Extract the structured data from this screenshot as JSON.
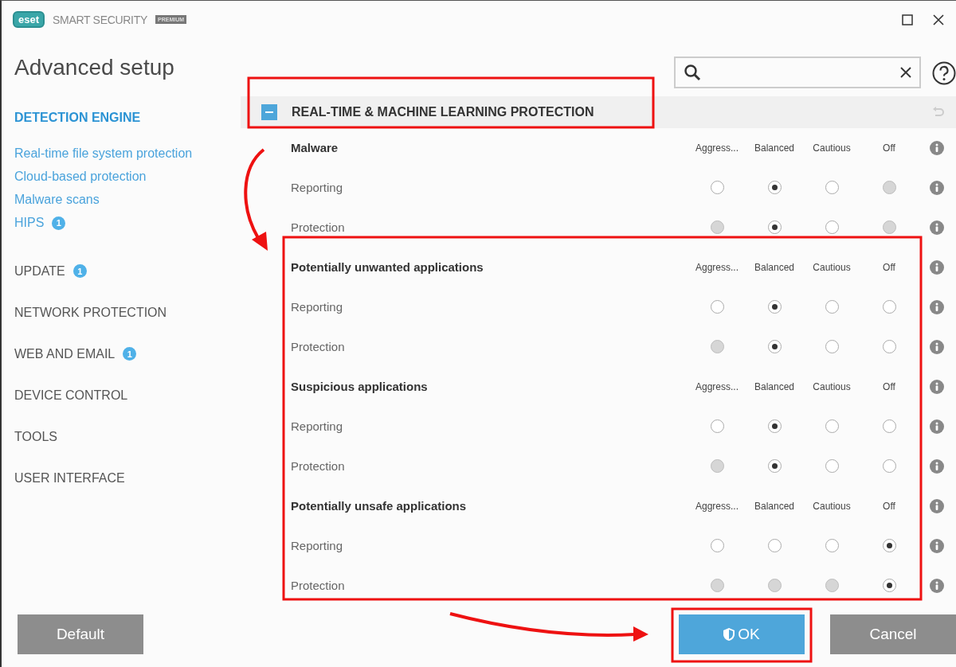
{
  "window": {
    "logo": "eset",
    "product": "SMART SECURITY",
    "edition": "PREMIUM"
  },
  "page_title": "Advanced setup",
  "sidebar": {
    "sections": [
      {
        "label": "DETECTION ENGINE",
        "selected": true,
        "children": [
          {
            "label": "Real-time file system protection"
          },
          {
            "label": "Cloud-based protection"
          },
          {
            "label": "Malware scans"
          },
          {
            "label": "HIPS",
            "badge": "1"
          }
        ]
      },
      {
        "label": "UPDATE",
        "badge": "1",
        "selected": false
      },
      {
        "label": "NETWORK PROTECTION",
        "selected": false
      },
      {
        "label": "WEB AND EMAIL",
        "badge": "1",
        "selected": false
      },
      {
        "label": "DEVICE CONTROL",
        "selected": false
      },
      {
        "label": "TOOLS",
        "selected": false
      },
      {
        "label": "USER INTERFACE",
        "selected": false
      }
    ]
  },
  "panel": {
    "title": "REAL-TIME & MACHINE LEARNING PROTECTION",
    "expanded": true,
    "groups": [
      {
        "name": "Malware",
        "levels": [
          "Aggress...",
          "Balanced",
          "Cautious",
          "Off"
        ],
        "rows": [
          {
            "label": "Reporting",
            "options": [
              {
                "selected": false,
                "disabled": false
              },
              {
                "selected": true,
                "disabled": false
              },
              {
                "selected": false,
                "disabled": false
              },
              {
                "selected": false,
                "disabled": true
              }
            ]
          },
          {
            "label": "Protection",
            "options": [
              {
                "selected": false,
                "disabled": true
              },
              {
                "selected": true,
                "disabled": false
              },
              {
                "selected": false,
                "disabled": false
              },
              {
                "selected": false,
                "disabled": true
              }
            ]
          }
        ]
      },
      {
        "name": "Potentially unwanted applications",
        "levels": [
          "Aggress...",
          "Balanced",
          "Cautious",
          "Off"
        ],
        "rows": [
          {
            "label": "Reporting",
            "options": [
              {
                "selected": false,
                "disabled": false
              },
              {
                "selected": true,
                "disabled": false
              },
              {
                "selected": false,
                "disabled": false
              },
              {
                "selected": false,
                "disabled": false
              }
            ]
          },
          {
            "label": "Protection",
            "options": [
              {
                "selected": false,
                "disabled": true
              },
              {
                "selected": true,
                "disabled": false
              },
              {
                "selected": false,
                "disabled": false
              },
              {
                "selected": false,
                "disabled": false
              }
            ]
          }
        ]
      },
      {
        "name": "Suspicious applications",
        "levels": [
          "Aggress...",
          "Balanced",
          "Cautious",
          "Off"
        ],
        "rows": [
          {
            "label": "Reporting",
            "options": [
              {
                "selected": false,
                "disabled": false
              },
              {
                "selected": true,
                "disabled": false
              },
              {
                "selected": false,
                "disabled": false
              },
              {
                "selected": false,
                "disabled": false
              }
            ]
          },
          {
            "label": "Protection",
            "options": [
              {
                "selected": false,
                "disabled": true
              },
              {
                "selected": true,
                "disabled": false
              },
              {
                "selected": false,
                "disabled": false
              },
              {
                "selected": false,
                "disabled": false
              }
            ]
          }
        ]
      },
      {
        "name": "Potentially unsafe applications",
        "levels": [
          "Aggress...",
          "Balanced",
          "Cautious",
          "Off"
        ],
        "rows": [
          {
            "label": "Reporting",
            "options": [
              {
                "selected": false,
                "disabled": false
              },
              {
                "selected": false,
                "disabled": false
              },
              {
                "selected": false,
                "disabled": false
              },
              {
                "selected": true,
                "disabled": false
              }
            ]
          },
          {
            "label": "Protection",
            "options": [
              {
                "selected": false,
                "disabled": true
              },
              {
                "selected": false,
                "disabled": true
              },
              {
                "selected": false,
                "disabled": true
              },
              {
                "selected": true,
                "disabled": false
              }
            ]
          }
        ]
      }
    ]
  },
  "buttons": [
    {
      "label": "Default",
      "kind": "secondary"
    },
    {
      "label": "OK",
      "kind": "primary"
    },
    {
      "label": "Cancel",
      "kind": "secondary"
    }
  ]
}
